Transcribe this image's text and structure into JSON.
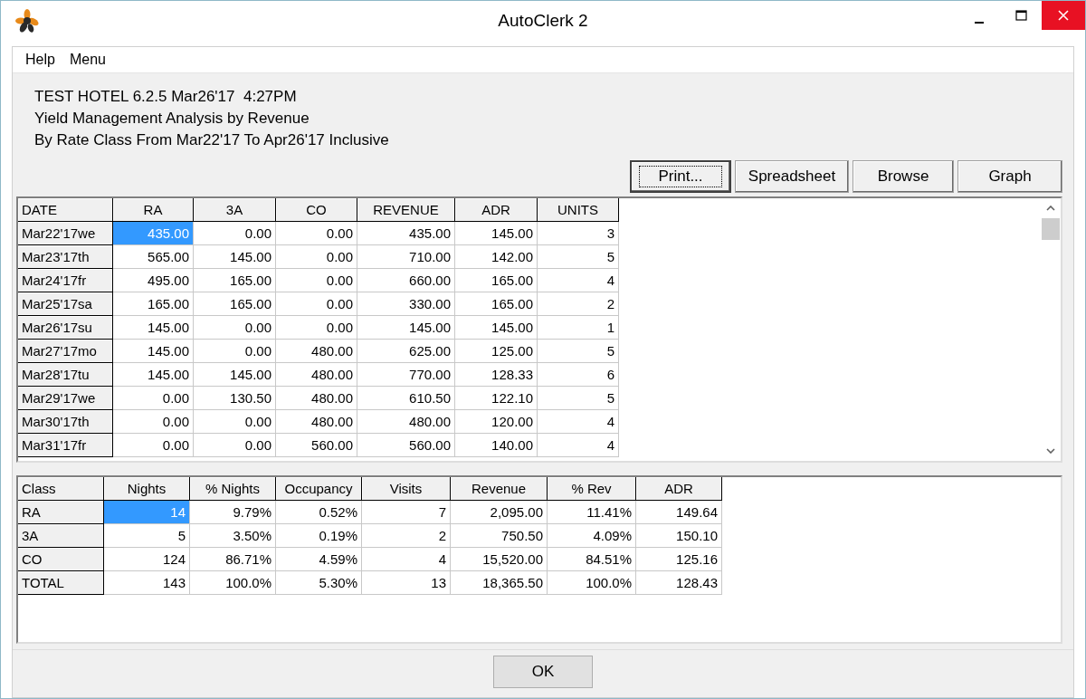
{
  "window": {
    "title": "AutoClerk 2"
  },
  "menu": [
    "Help",
    "Menu"
  ],
  "header_lines": [
    "TEST HOTEL 6.2.5 Mar26'17  4:27PM",
    "Yield Management Analysis by Revenue",
    "By Rate Class From Mar22'17 To Apr26'17 Inclusive"
  ],
  "buttons": [
    {
      "label": "Print...",
      "focused": true
    },
    {
      "label": "Spreadsheet",
      "focused": false
    },
    {
      "label": "Browse",
      "focused": false
    },
    {
      "label": "Graph",
      "focused": false
    }
  ],
  "daily_table": {
    "columns": [
      "DATE",
      "RA",
      "3A",
      "CO",
      "REVENUE",
      "ADR",
      "UNITS"
    ],
    "rows": [
      {
        "cells": [
          {
            "text": "Mar22'17we",
            "selected": false
          },
          {
            "text": "435.00",
            "selected": true
          },
          {
            "text": "0.00",
            "selected": false
          },
          {
            "text": "0.00",
            "selected": false
          },
          {
            "text": "435.00",
            "selected": false
          },
          {
            "text": "145.00",
            "selected": false
          },
          {
            "text": "3",
            "selected": false
          }
        ]
      },
      {
        "cells": [
          {
            "text": "Mar23'17th",
            "selected": false
          },
          {
            "text": "565.00",
            "selected": false
          },
          {
            "text": "145.00",
            "selected": false
          },
          {
            "text": "0.00",
            "selected": false
          },
          {
            "text": "710.00",
            "selected": false
          },
          {
            "text": "142.00",
            "selected": false
          },
          {
            "text": "5",
            "selected": false
          }
        ]
      },
      {
        "cells": [
          {
            "text": "Mar24'17fr",
            "selected": false
          },
          {
            "text": "495.00",
            "selected": false
          },
          {
            "text": "165.00",
            "selected": false
          },
          {
            "text": "0.00",
            "selected": false
          },
          {
            "text": "660.00",
            "selected": false
          },
          {
            "text": "165.00",
            "selected": false
          },
          {
            "text": "4",
            "selected": false
          }
        ]
      },
      {
        "cells": [
          {
            "text": "Mar25'17sa",
            "selected": false
          },
          {
            "text": "165.00",
            "selected": false
          },
          {
            "text": "165.00",
            "selected": false
          },
          {
            "text": "0.00",
            "selected": false
          },
          {
            "text": "330.00",
            "selected": false
          },
          {
            "text": "165.00",
            "selected": false
          },
          {
            "text": "2",
            "selected": false
          }
        ]
      },
      {
        "cells": [
          {
            "text": "Mar26'17su",
            "selected": false
          },
          {
            "text": "145.00",
            "selected": false
          },
          {
            "text": "0.00",
            "selected": false
          },
          {
            "text": "0.00",
            "selected": false
          },
          {
            "text": "145.00",
            "selected": false
          },
          {
            "text": "145.00",
            "selected": false
          },
          {
            "text": "1",
            "selected": false
          }
        ]
      },
      {
        "cells": [
          {
            "text": "Mar27'17mo",
            "selected": false
          },
          {
            "text": "145.00",
            "selected": false
          },
          {
            "text": "0.00",
            "selected": false
          },
          {
            "text": "480.00",
            "selected": false
          },
          {
            "text": "625.00",
            "selected": false
          },
          {
            "text": "125.00",
            "selected": false
          },
          {
            "text": "5",
            "selected": false
          }
        ]
      },
      {
        "cells": [
          {
            "text": "Mar28'17tu",
            "selected": false
          },
          {
            "text": "145.00",
            "selected": false
          },
          {
            "text": "145.00",
            "selected": false
          },
          {
            "text": "480.00",
            "selected": false
          },
          {
            "text": "770.00",
            "selected": false
          },
          {
            "text": "128.33",
            "selected": false
          },
          {
            "text": "6",
            "selected": false
          }
        ]
      },
      {
        "cells": [
          {
            "text": "Mar29'17we",
            "selected": false
          },
          {
            "text": "0.00",
            "selected": false
          },
          {
            "text": "130.50",
            "selected": false
          },
          {
            "text": "480.00",
            "selected": false
          },
          {
            "text": "610.50",
            "selected": false
          },
          {
            "text": "122.10",
            "selected": false
          },
          {
            "text": "5",
            "selected": false
          }
        ]
      },
      {
        "cells": [
          {
            "text": "Mar30'17th",
            "selected": false
          },
          {
            "text": "0.00",
            "selected": false
          },
          {
            "text": "0.00",
            "selected": false
          },
          {
            "text": "480.00",
            "selected": false
          },
          {
            "text": "480.00",
            "selected": false
          },
          {
            "text": "120.00",
            "selected": false
          },
          {
            "text": "4",
            "selected": false
          }
        ]
      },
      {
        "cells": [
          {
            "text": "Mar31'17fr",
            "selected": false
          },
          {
            "text": "0.00",
            "selected": false
          },
          {
            "text": "0.00",
            "selected": false
          },
          {
            "text": "560.00",
            "selected": false
          },
          {
            "text": "560.00",
            "selected": false
          },
          {
            "text": "140.00",
            "selected": false
          },
          {
            "text": "4",
            "selected": false
          }
        ]
      }
    ]
  },
  "class_table": {
    "columns": [
      "Class",
      "Nights",
      "% Nights",
      "Occupancy",
      "Visits",
      "Revenue",
      "% Rev",
      "ADR"
    ],
    "rows": [
      {
        "cells": [
          {
            "text": "RA",
            "selected": false
          },
          {
            "text": "14",
            "selected": true
          },
          {
            "text": "9.79%",
            "selected": false
          },
          {
            "text": "0.52%",
            "selected": false
          },
          {
            "text": "7",
            "selected": false
          },
          {
            "text": "2,095.00",
            "selected": false
          },
          {
            "text": "11.41%",
            "selected": false
          },
          {
            "text": "149.64",
            "selected": false
          }
        ]
      },
      {
        "cells": [
          {
            "text": "3A",
            "selected": false
          },
          {
            "text": "5",
            "selected": false
          },
          {
            "text": "3.50%",
            "selected": false
          },
          {
            "text": "0.19%",
            "selected": false
          },
          {
            "text": "2",
            "selected": false
          },
          {
            "text": "750.50",
            "selected": false
          },
          {
            "text": "4.09%",
            "selected": false
          },
          {
            "text": "150.10",
            "selected": false
          }
        ]
      },
      {
        "cells": [
          {
            "text": "CO",
            "selected": false
          },
          {
            "text": "124",
            "selected": false
          },
          {
            "text": "86.71%",
            "selected": false
          },
          {
            "text": "4.59%",
            "selected": false
          },
          {
            "text": "4",
            "selected": false
          },
          {
            "text": "15,520.00",
            "selected": false
          },
          {
            "text": "84.51%",
            "selected": false
          },
          {
            "text": "125.16",
            "selected": false
          }
        ]
      },
      {
        "cells": [
          {
            "text": "TOTAL",
            "selected": false
          },
          {
            "text": "143",
            "selected": false
          },
          {
            "text": "100.0%",
            "selected": false
          },
          {
            "text": "5.30%",
            "selected": false
          },
          {
            "text": "13",
            "selected": false
          },
          {
            "text": "18,365.50",
            "selected": false
          },
          {
            "text": "100.0%",
            "selected": false
          },
          {
            "text": "128.43",
            "selected": false
          }
        ]
      }
    ]
  },
  "ok_button": "OK"
}
